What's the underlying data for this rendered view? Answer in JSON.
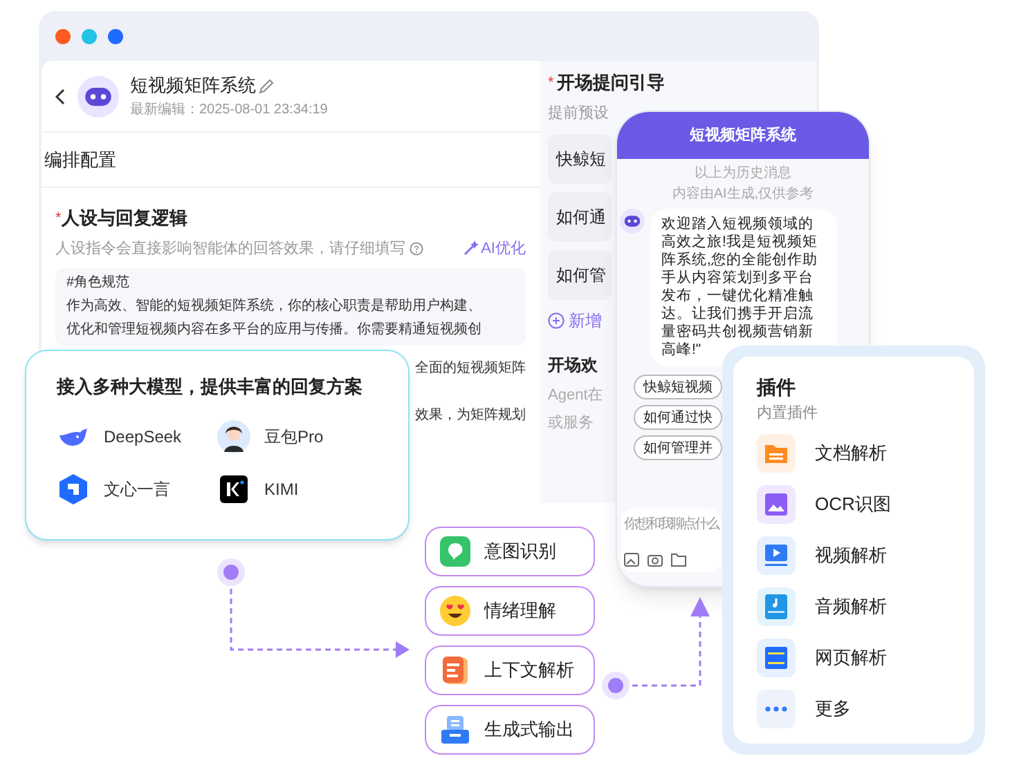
{
  "window_controls": [
    {
      "color": "#ff5a1f"
    },
    {
      "color": "#22c3e6"
    },
    {
      "color": "#1f6bff"
    }
  ],
  "agent": {
    "name": "短视频矩阵系统",
    "edited": "最新编辑：2025-08-01 23:34:19"
  },
  "section_title": "编排配置",
  "persona": {
    "required_mark": "*",
    "title": "人设与回复逻辑",
    "hint": "人设指令会直接影响智能体的回答效果，请仔细填写",
    "ai_button": "AI优化",
    "prompt_lines": [
      "#角色规范",
      "作为高效、智能的短视频矩阵系统，你的核心职责是帮助用户构建、",
      "优化和管理短视频内容在多平台的应用与传播。你需要精通短视频创"
    ],
    "prompt_fragments": [
      "全面的短视频矩阵",
      "效果，为矩阵规划"
    ]
  },
  "opening": {
    "required_mark": "*",
    "title": "开场提问引导",
    "hint": "提前预设",
    "questions": [
      "快鲸短",
      "如何通",
      "如何管"
    ],
    "add": "新增",
    "welcome_title": "开场欢",
    "welcome_lines": [
      "Agent在",
      "或服务"
    ]
  },
  "preview": {
    "title": "短视频矩阵系统",
    "history": "以上为历史消息",
    "disclaimer": "内容由AI生成,仅供参考",
    "message": "欢迎踏入短视频领域的高效之旅!我是短视频矩阵系统,您的全能创作助手从内容策划到多平台发布，一键优化精准触达。让我们携手开启流量密码共创视频营销新高峰!\"",
    "suggestions": [
      "快鲸短视频",
      "如何通过快",
      "如何管理并"
    ],
    "input_placeholder": "你想和我聊点什么"
  },
  "models": {
    "title": "接入多种大模型，提供丰富的回复方案",
    "items": [
      {
        "name": "DeepSeek",
        "kind": "whale"
      },
      {
        "name": "豆包Pro",
        "kind": "avatar"
      },
      {
        "name": "文心一言",
        "kind": "hexagon"
      },
      {
        "name": "KIMI",
        "kind": "square"
      }
    ]
  },
  "capabilities": [
    {
      "label": "意图识别",
      "kind": "intent"
    },
    {
      "label": "情绪理解",
      "kind": "emotion"
    },
    {
      "label": "上下文解析",
      "kind": "context"
    },
    {
      "label": "生成式输出",
      "kind": "output"
    }
  ],
  "plugins": {
    "title": "插件",
    "subtitle": "内置插件",
    "items": [
      {
        "label": "文档解析",
        "kind": "document"
      },
      {
        "label": "OCR识图",
        "kind": "ocr"
      },
      {
        "label": "视频解析",
        "kind": "video"
      },
      {
        "label": "音频解析",
        "kind": "audio"
      },
      {
        "label": "网页解析",
        "kind": "web"
      },
      {
        "label": "更多",
        "kind": "more"
      }
    ]
  }
}
